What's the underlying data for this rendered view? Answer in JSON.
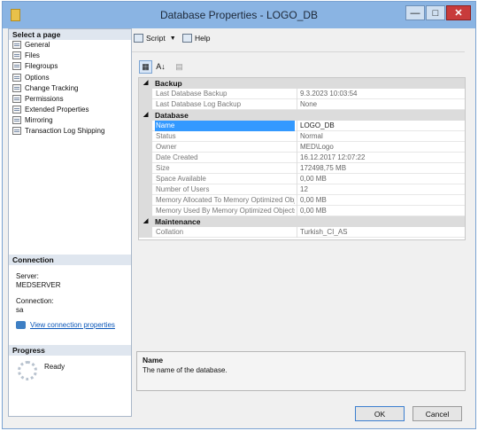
{
  "window": {
    "title": "Database Properties - LOGO_DB"
  },
  "controls": {
    "minimize": "—",
    "maximize": "□",
    "close": "✕"
  },
  "left_panel": {
    "select_page_header": "Select a page",
    "pages": [
      {
        "label": "General"
      },
      {
        "label": "Files"
      },
      {
        "label": "Filegroups"
      },
      {
        "label": "Options"
      },
      {
        "label": "Change Tracking"
      },
      {
        "label": "Permissions"
      },
      {
        "label": "Extended Properties"
      },
      {
        "label": "Mirroring"
      },
      {
        "label": "Transaction Log Shipping"
      }
    ],
    "connection": {
      "header": "Connection",
      "server_label": "Server:",
      "server_value": "MEDSERVER",
      "connection_label": "Connection:",
      "connection_value": "sa",
      "link": "View connection properties"
    },
    "progress": {
      "header": "Progress",
      "status": "Ready"
    }
  },
  "toolbar": {
    "script_label": "Script",
    "help_label": "Help"
  },
  "grid_toolbar": {
    "categorized": "▦",
    "alphabetical": "A↓",
    "pages": "▤"
  },
  "property_grid": {
    "categories": [
      {
        "name": "Backup",
        "toggle": "◢",
        "rows": [
          {
            "name": "Last Database Backup",
            "value": "9.3.2023 10:03:54"
          },
          {
            "name": "Last Database Log Backup",
            "value": "None"
          }
        ]
      },
      {
        "name": "Database",
        "toggle": "◢",
        "rows": [
          {
            "name": "Name",
            "value": "LOGO_DB"
          },
          {
            "name": "Status",
            "value": "Normal"
          },
          {
            "name": "Owner",
            "value": "MED\\Logo"
          },
          {
            "name": "Date Created",
            "value": "16.12.2017 12:07:22"
          },
          {
            "name": "Size",
            "value": "172498,75 MB"
          },
          {
            "name": "Space Available",
            "value": "0,00 MB"
          },
          {
            "name": "Number of Users",
            "value": "12"
          },
          {
            "name": "Memory Allocated To Memory Optimized Obj",
            "value": "0,00 MB"
          },
          {
            "name": "Memory Used By Memory Optimized Objects",
            "value": "0,00 MB"
          }
        ]
      },
      {
        "name": "Maintenance",
        "toggle": "◢",
        "rows": [
          {
            "name": "Collation",
            "value": "Turkish_CI_AS"
          }
        ]
      }
    ]
  },
  "description": {
    "title": "Name",
    "text": "The name of the database."
  },
  "buttons": {
    "ok": "OK",
    "cancel": "Cancel"
  }
}
